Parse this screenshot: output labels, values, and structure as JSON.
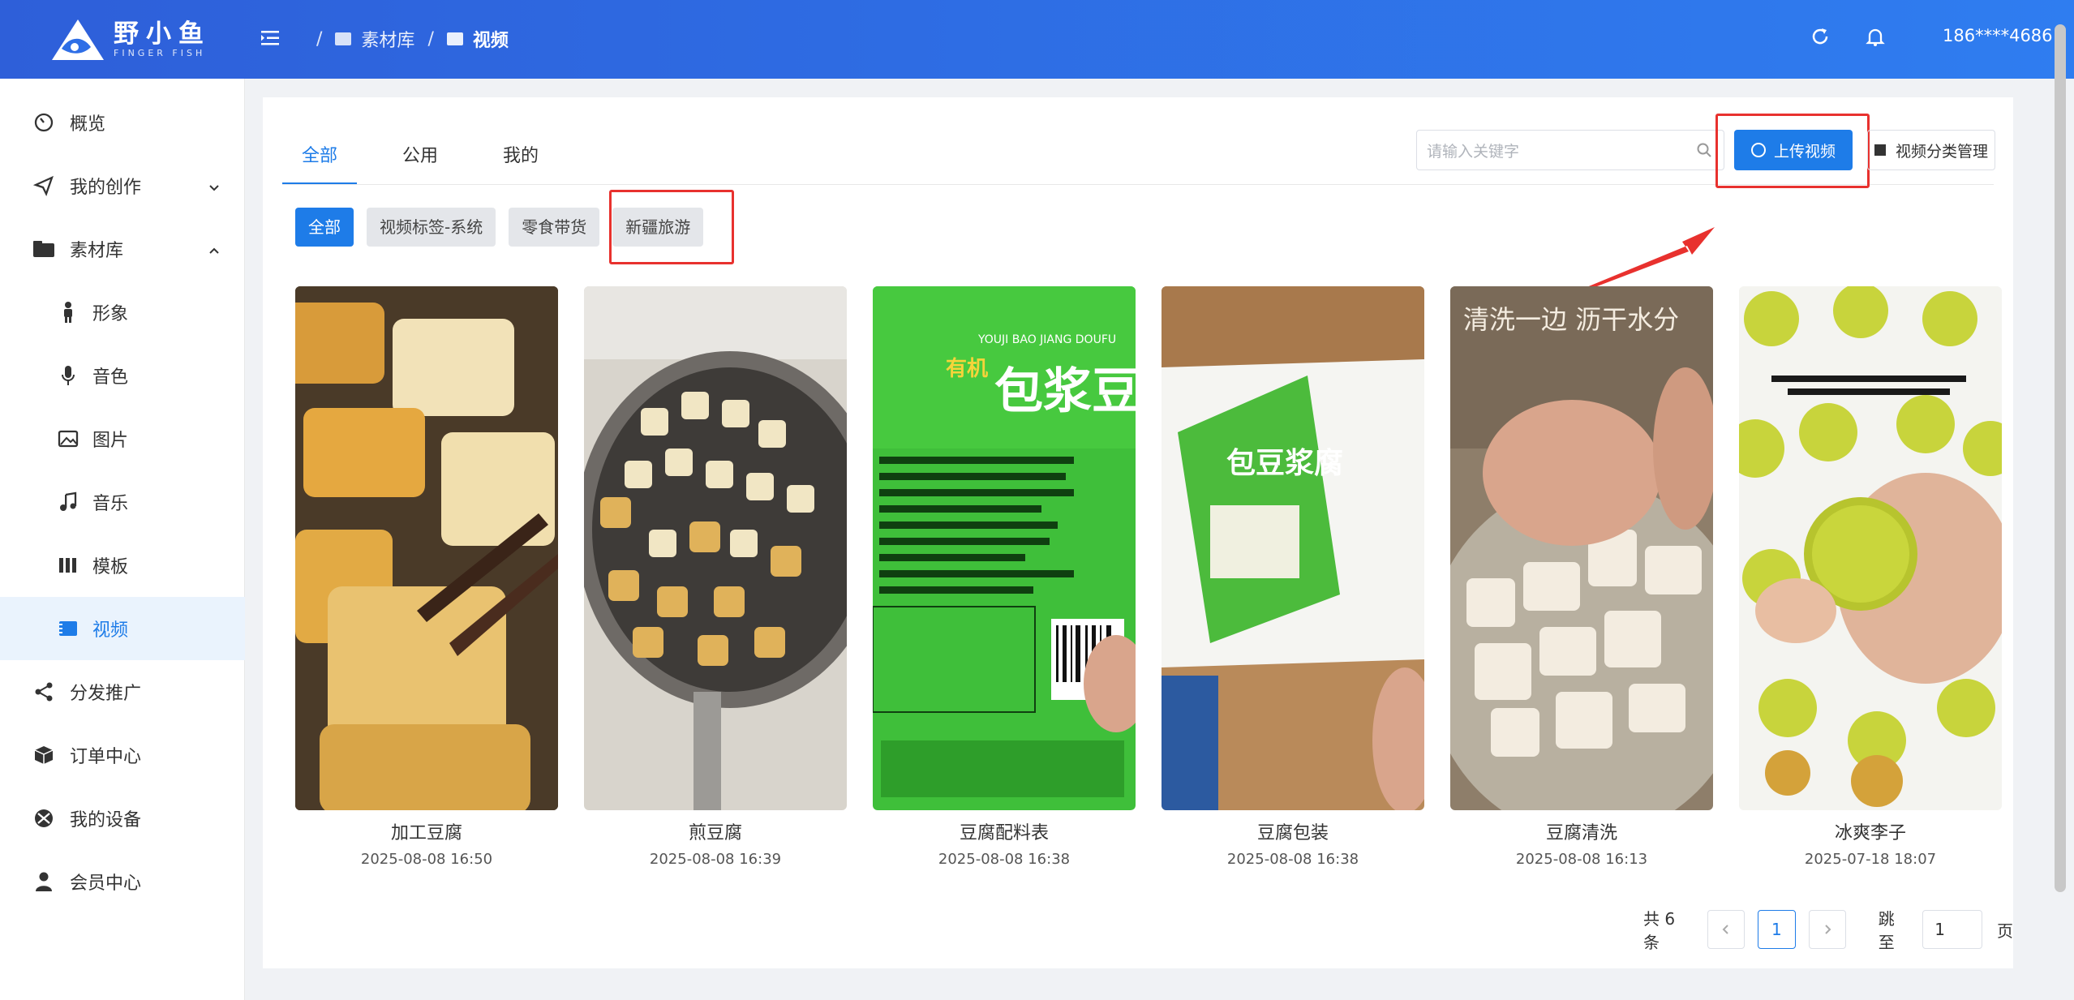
{
  "app": {
    "logo_cn": "野小鱼",
    "logo_en": "FINGER FISH"
  },
  "breadcrumb": {
    "sep": "/",
    "items": [
      "素材库",
      "视频"
    ]
  },
  "header": {
    "user": "186****4686"
  },
  "sidebar": {
    "items": [
      {
        "label": "概览",
        "icon": "dashboard-icon"
      },
      {
        "label": "我的创作",
        "icon": "paper-plane-icon"
      },
      {
        "label": "素材库",
        "icon": "folder-icon"
      },
      {
        "label": "形象",
        "icon": "person-icon"
      },
      {
        "label": "音色",
        "icon": "microphone-icon"
      },
      {
        "label": "图片",
        "icon": "image-icon"
      },
      {
        "label": "音乐",
        "icon": "music-icon"
      },
      {
        "label": "模板",
        "icon": "template-icon"
      },
      {
        "label": "视频",
        "icon": "video-icon"
      },
      {
        "label": "分发推广",
        "icon": "share-icon"
      },
      {
        "label": "订单中心",
        "icon": "box-icon"
      },
      {
        "label": "我的设备",
        "icon": "device-icon"
      },
      {
        "label": "会员中心",
        "icon": "user-icon"
      }
    ]
  },
  "tabs": [
    "全部",
    "公用",
    "我的"
  ],
  "search": {
    "placeholder": "请输入关键字"
  },
  "toolbar": {
    "upload": "上传视频",
    "manage": "视频分类管理"
  },
  "chips": [
    "全部",
    "视频标签-系统",
    "零食带货",
    "新疆旅游"
  ],
  "videos": [
    {
      "title": "加工豆腐",
      "date": "2025-08-08 16:50"
    },
    {
      "title": "煎豆腐",
      "date": "2025-08-08 16:39"
    },
    {
      "title": "豆腐配料表",
      "date": "2025-08-08 16:38"
    },
    {
      "title": "豆腐包装",
      "date": "2025-08-08 16:38"
    },
    {
      "title": "豆腐清洗",
      "date": "2025-08-08 16:13"
    },
    {
      "title": "冰爽李子",
      "date": "2025-07-18 18:07"
    }
  ],
  "thumb_text": {
    "t3_brand": "包浆豆",
    "t3_tag": "有机",
    "t3_sub": "YOUJI BAO JIANG DOUFU",
    "t4_pack": "包豆浆腐",
    "t5_caption": "清洗一边 沥干水分"
  },
  "pagination": {
    "total": "共 6 条",
    "current": "1",
    "jump_label": "跳至",
    "jump_value": "1",
    "unit": "页"
  },
  "colors": {
    "primary": "#1e7ce8",
    "header": "#2e6ee6",
    "highlight": "#e8312e"
  }
}
